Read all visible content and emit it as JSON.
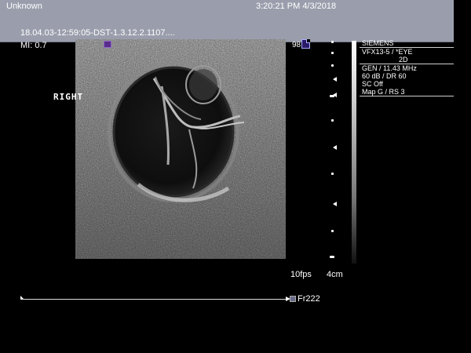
{
  "header": {
    "patient": "Unknown",
    "datetime": "3:20:21 PM 4/3/2018",
    "study": "18.04.03-12:59:05-DST-1.3.12.2.1107...."
  },
  "mi": "MI: 0.7",
  "orientation_label": "RIGHT",
  "frame_index_top": "98",
  "info_panel": {
    "manufacturer": "SIEMENS",
    "transducer": "VFX13-5 / *EYE",
    "mode": "2D",
    "lines": [
      "GEN / 11.43 MHz",
      "60 dB / DR 60",
      "SC Off",
      "Map G / RS 3"
    ]
  },
  "frame_rate": "10fps",
  "depth": "4cm",
  "cine": {
    "frame": "Fr222"
  },
  "icons": [
    "orientation-marker-icon",
    "document-icon",
    "frame-icon"
  ],
  "colors": {
    "header_bg": "#9a9eac",
    "marker": "#5a2c8c"
  }
}
